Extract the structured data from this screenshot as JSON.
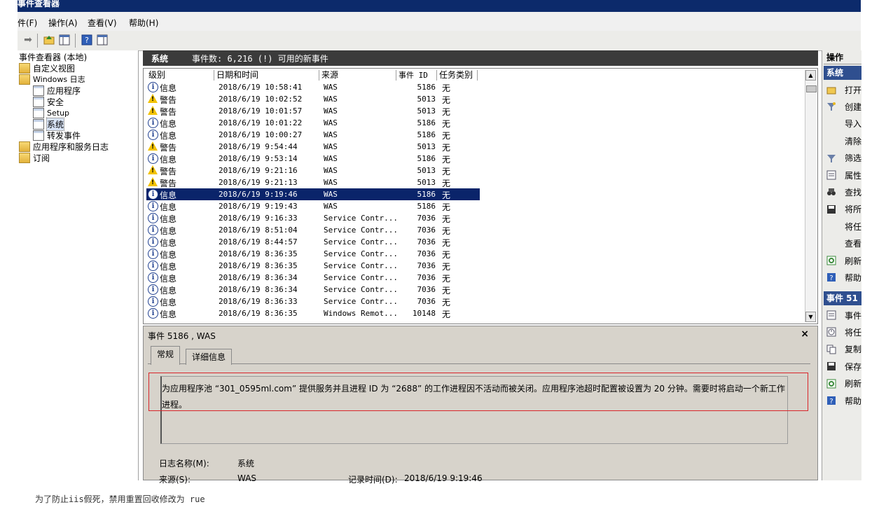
{
  "window": {
    "title": "事件查看器"
  },
  "menu": [
    "件(F)",
    "操作(A)",
    "查看(V)",
    "帮助(H)"
  ],
  "tree": {
    "items": [
      {
        "label": "事件查看器 (本地)",
        "icon": "log-icon",
        "indent": 0
      },
      {
        "label": "自定义视图",
        "icon": "folder-icon",
        "indent": 1
      },
      {
        "label": "Windows 日志",
        "icon": "folder-icon",
        "indent": 1
      },
      {
        "label": "应用程序",
        "icon": "log-icon",
        "indent": 2
      },
      {
        "label": "安全",
        "icon": "log-icon",
        "indent": 2
      },
      {
        "label": "Setup",
        "icon": "log-icon",
        "indent": 2
      },
      {
        "label": "系统",
        "icon": "log-icon",
        "indent": 2,
        "selected": true
      },
      {
        "label": "转发事件",
        "icon": "log-icon",
        "indent": 2
      },
      {
        "label": "应用程序和服务日志",
        "icon": "folder-icon",
        "indent": 1
      },
      {
        "label": "订阅",
        "icon": "folder-icon",
        "indent": 1
      }
    ]
  },
  "header": {
    "log_name": "系统",
    "summary": "事件数: 6,216 (!) 可用的新事件"
  },
  "columns": [
    "级别",
    "日期和时间",
    "来源",
    "事件 ID",
    "任务类别"
  ],
  "events": [
    {
      "level": "信息",
      "type": "info",
      "datetime": "2018/6/19 10:58:41",
      "source": "WAS",
      "id": "5186",
      "task": "无"
    },
    {
      "level": "警告",
      "type": "warn",
      "datetime": "2018/6/19 10:02:52",
      "source": "WAS",
      "id": "5013",
      "task": "无"
    },
    {
      "level": "警告",
      "type": "warn",
      "datetime": "2018/6/19 10:01:57",
      "source": "WAS",
      "id": "5013",
      "task": "无"
    },
    {
      "level": "信息",
      "type": "info",
      "datetime": "2018/6/19 10:01:22",
      "source": "WAS",
      "id": "5186",
      "task": "无"
    },
    {
      "level": "信息",
      "type": "info",
      "datetime": "2018/6/19 10:00:27",
      "source": "WAS",
      "id": "5186",
      "task": "无"
    },
    {
      "level": "警告",
      "type": "warn",
      "datetime": "2018/6/19 9:54:44",
      "source": "WAS",
      "id": "5013",
      "task": "无"
    },
    {
      "level": "信息",
      "type": "info",
      "datetime": "2018/6/19 9:53:14",
      "source": "WAS",
      "id": "5186",
      "task": "无"
    },
    {
      "level": "警告",
      "type": "warn",
      "datetime": "2018/6/19 9:21:16",
      "source": "WAS",
      "id": "5013",
      "task": "无"
    },
    {
      "level": "警告",
      "type": "warn",
      "datetime": "2018/6/19 9:21:13",
      "source": "WAS",
      "id": "5013",
      "task": "无"
    },
    {
      "level": "信息",
      "type": "info",
      "datetime": "2018/6/19 9:19:46",
      "source": "WAS",
      "id": "5186",
      "task": "无",
      "selected": true
    },
    {
      "level": "信息",
      "type": "info",
      "datetime": "2018/6/19 9:19:43",
      "source": "WAS",
      "id": "5186",
      "task": "无"
    },
    {
      "level": "信息",
      "type": "info",
      "datetime": "2018/6/19 9:16:33",
      "source": "Service Contr...",
      "id": "7036",
      "task": "无"
    },
    {
      "level": "信息",
      "type": "info",
      "datetime": "2018/6/19 8:51:04",
      "source": "Service Contr...",
      "id": "7036",
      "task": "无"
    },
    {
      "level": "信息",
      "type": "info",
      "datetime": "2018/6/19 8:44:57",
      "source": "Service Contr...",
      "id": "7036",
      "task": "无"
    },
    {
      "level": "信息",
      "type": "info",
      "datetime": "2018/6/19 8:36:35",
      "source": "Service Contr...",
      "id": "7036",
      "task": "无"
    },
    {
      "level": "信息",
      "type": "info",
      "datetime": "2018/6/19 8:36:35",
      "source": "Service Contr...",
      "id": "7036",
      "task": "无"
    },
    {
      "level": "信息",
      "type": "info",
      "datetime": "2018/6/19 8:36:34",
      "source": "Service Contr...",
      "id": "7036",
      "task": "无"
    },
    {
      "level": "信息",
      "type": "info",
      "datetime": "2018/6/19 8:36:34",
      "source": "Service Contr...",
      "id": "7036",
      "task": "无"
    },
    {
      "level": "信息",
      "type": "info",
      "datetime": "2018/6/19 8:36:33",
      "source": "Service Contr...",
      "id": "7036",
      "task": "无"
    },
    {
      "level": "信息",
      "type": "info",
      "datetime": "2018/6/19 8:36:35",
      "source": "Windows Remot...",
      "id": "10148",
      "task": "无"
    }
  ],
  "detail": {
    "title": "事件 5186 , WAS",
    "close": "×",
    "tabs": [
      "常规",
      "详细信息"
    ],
    "description": "为应用程序池 “301_0595ml.com” 提供服务并且进程 ID 为 “2688” 的工作进程因不活动而被关闭。应用程序池超时配置被设置为 20 分钟。需要时将启动一个新工作进程。",
    "fields": {
      "log_label": "日志名称(M):",
      "log_value": "系统",
      "source_label": "来源(S):",
      "source_value": "WAS",
      "time_label": "记录时间(D):",
      "time_value": "2018/6/19 9:19:46"
    }
  },
  "actions": {
    "header": "操作",
    "section1": "系统",
    "items1": [
      {
        "label": "打开",
        "icon": "folder-open-icon"
      },
      {
        "label": "创建",
        "icon": "filter-create-icon"
      },
      {
        "label": "导入",
        "icon": ""
      },
      {
        "label": "清除",
        "icon": ""
      },
      {
        "label": "筛选",
        "icon": "filter-icon"
      },
      {
        "label": "属性",
        "icon": "properties-icon"
      },
      {
        "label": "查找",
        "icon": "binoculars-icon"
      },
      {
        "label": "将所",
        "icon": "save-icon"
      },
      {
        "label": "将任",
        "icon": ""
      },
      {
        "label": "查看",
        "icon": ""
      },
      {
        "label": "刷新",
        "icon": "refresh-icon"
      },
      {
        "label": "帮助",
        "icon": "help-icon"
      }
    ],
    "section2": "事件 51",
    "items2": [
      {
        "label": "事件",
        "icon": "properties-icon"
      },
      {
        "label": "将任",
        "icon": "clock-icon"
      },
      {
        "label": "复制",
        "icon": "copy-icon"
      },
      {
        "label": "保存",
        "icon": "save-icon"
      },
      {
        "label": "刷新",
        "icon": "refresh-icon"
      },
      {
        "label": "帮助",
        "icon": "help-icon"
      }
    ]
  },
  "colors": {
    "titlebar": "#0c2a6b",
    "selection": "#0a246a",
    "header": "#3b3b3b",
    "action_head": "#2f4f8f",
    "highlight": "#d9252a"
  },
  "caption": "为了防止iis假死，禁用重置回收修改为 rue"
}
